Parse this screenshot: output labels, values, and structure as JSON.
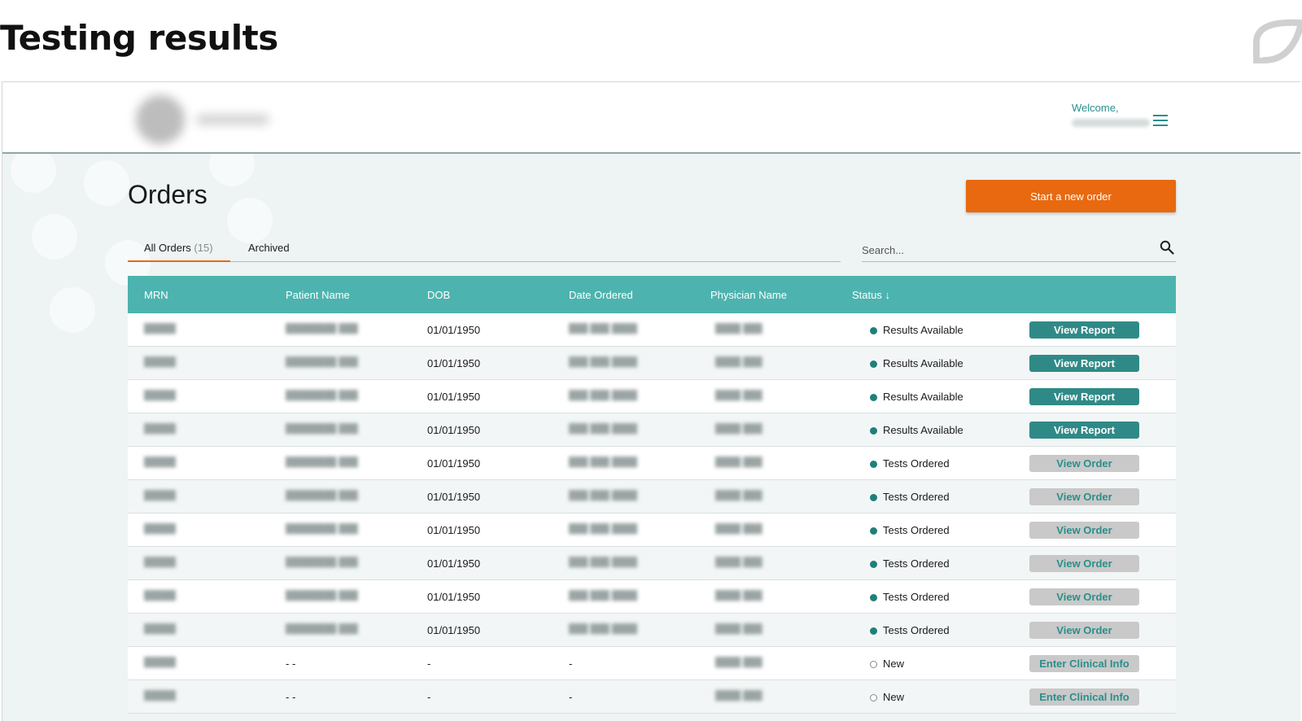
{
  "slide": {
    "title": "Testing results"
  },
  "header": {
    "welcome": "Welcome,"
  },
  "page": {
    "title": "Orders",
    "new_order_label": "Start a new order",
    "tabs": [
      {
        "label": "All Orders",
        "count": "(15)"
      },
      {
        "label": "Archived"
      }
    ],
    "search_placeholder": "Search..."
  },
  "table": {
    "columns": [
      "MRN",
      "Patient Name",
      "DOB",
      "Date Ordered",
      "Physician Name",
      "Status ↓"
    ],
    "rows": [
      {
        "dob": "01/01/1950",
        "date": "",
        "status": "Results Available",
        "action": "View Report",
        "kind": "report"
      },
      {
        "dob": "01/01/1950",
        "date": "",
        "status": "Results Available",
        "action": "View Report",
        "kind": "report"
      },
      {
        "dob": "01/01/1950",
        "date": "",
        "status": "Results Available",
        "action": "View Report",
        "kind": "report"
      },
      {
        "dob": "01/01/1950",
        "date": "",
        "status": "Results Available",
        "action": "View Report",
        "kind": "report"
      },
      {
        "dob": "01/01/1950",
        "date": "",
        "status": "Tests Ordered",
        "action": "View Order",
        "kind": "order"
      },
      {
        "dob": "01/01/1950",
        "date": "",
        "status": "Tests Ordered",
        "action": "View Order",
        "kind": "order"
      },
      {
        "dob": "01/01/1950",
        "date": "",
        "status": "Tests Ordered",
        "action": "View Order",
        "kind": "order"
      },
      {
        "dob": "01/01/1950",
        "date": "",
        "status": "Tests Ordered",
        "action": "View Order",
        "kind": "order"
      },
      {
        "dob": "01/01/1950",
        "date": "",
        "status": "Tests Ordered",
        "action": "View Order",
        "kind": "order"
      },
      {
        "dob": "01/01/1950",
        "date": "",
        "status": "Tests Ordered",
        "action": "View Order",
        "kind": "order"
      },
      {
        "patient": "- -",
        "dob": "-",
        "date": "-",
        "status": "New",
        "action": "Enter Clinical Info",
        "kind": "clinical"
      },
      {
        "patient": "- -",
        "dob": "-",
        "date": "-",
        "status": "New",
        "action": "Enter Clinical Info",
        "kind": "clinical"
      }
    ]
  },
  "colors": {
    "accent": "#e8690f",
    "teal": "#4db3ae",
    "teal_dark": "#2f8a87"
  },
  "icons": {
    "search": "search-icon",
    "menu": "hamburger-menu-icon",
    "brand": "brand-leaf-icon"
  }
}
